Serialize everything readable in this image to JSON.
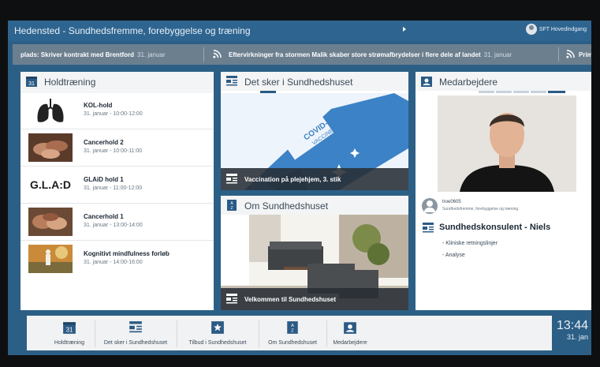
{
  "topbar": {
    "title": "Hedensted - Sundhedsfremme, forebyggelse og træning",
    "user": "SFT Hovedindgang"
  },
  "ticker": {
    "items": [
      {
        "text": "plads: Skriver kontrakt med Brentford",
        "date": "31. januar"
      },
      {
        "text": "Eftervirkninger fra stormen Malik skaber store strømafbrydelser i flere dele af landet",
        "date": "31. januar"
      },
      {
        "text": "Prim"
      }
    ]
  },
  "holdtraening": {
    "title": "Holdtræning",
    "items": [
      {
        "title": "KOL-hold",
        "date": "31. januar - 10:00-12:00"
      },
      {
        "title": "Cancerhold 2",
        "date": "31. januar - 10:00-11:00"
      },
      {
        "title": "GLAiD hold 1",
        "date": "31. januar - 11:00-12:00"
      },
      {
        "title": "Cancerhold 1",
        "date": "31. januar - 13:00-14:00"
      },
      {
        "title": "Kognitivt mindfulness forløb",
        "date": "31. januar - 14:00-16:00"
      }
    ],
    "glad_logo": "G.L.A:D"
  },
  "detsker": {
    "title": "Det sker i Sundhedshuset",
    "caption": "Vaccination på plejehjem, 3. stik",
    "vaccine_line1": "COVID-19",
    "vaccine_line2": "VACCINE"
  },
  "om": {
    "title": "Om Sundhedshuset",
    "caption": "Velkommen til Sundhedshuset"
  },
  "medarbejdere": {
    "title": "Medarbejdere",
    "username": "troe0605",
    "department": "Sundhedsfremme, forebyggelse og træning",
    "name": "Sundhedskonsulent - Niels",
    "bullets": [
      "- Kliniske retningslinjer",
      "- Analyse"
    ]
  },
  "tabs": [
    {
      "label": "Holdtræning",
      "icon": "calendar-icon"
    },
    {
      "label": "Det sker i Sundhedshuset",
      "icon": "news-icon"
    },
    {
      "label": "Tilbud i Sundhedshuset",
      "icon": "star-icon"
    },
    {
      "label": "Om Sundhedshuset",
      "icon": "az-icon"
    },
    {
      "label": "Medarbejdere",
      "icon": "contact-icon"
    }
  ],
  "clock": {
    "time": "13:44",
    "date": "31. jan"
  },
  "colors": {
    "accent": "#2e6590",
    "panel_header": "#f3f4f5",
    "icon_blue": "#2b5b85"
  }
}
